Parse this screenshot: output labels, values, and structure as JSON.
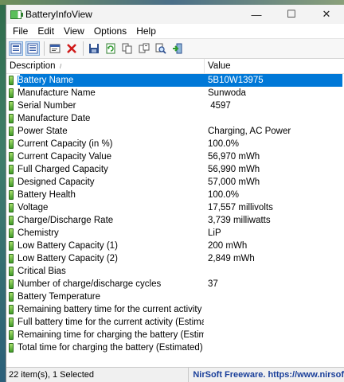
{
  "window": {
    "title": "BatteryInfoView",
    "minimize_glyph": "—",
    "maximize_glyph": "☐",
    "close_glyph": "✕"
  },
  "menu": [
    "File",
    "Edit",
    "View",
    "Options",
    "Help"
  ],
  "toolbar": {
    "icons": [
      "html-report-icon",
      "list-report-icon",
      "properties-icon",
      "delete-icon",
      "save-icon",
      "refresh-icon",
      "copy-icon",
      "copy-all-icon",
      "find-icon",
      "exit-icon"
    ]
  },
  "columns": {
    "description": "Description",
    "value": "Value",
    "sort_indicator": "/"
  },
  "rows": [
    {
      "description": "Battery Name",
      "value": "5B10W13975",
      "selected": true
    },
    {
      "description": "Manufacture Name",
      "value": "Sunwoda"
    },
    {
      "description": "Serial Number",
      "value": " 4597"
    },
    {
      "description": "Manufacture Date",
      "value": ""
    },
    {
      "description": "Power State",
      "value": "Charging, AC Power"
    },
    {
      "description": "Current Capacity (in %)",
      "value": "100.0%"
    },
    {
      "description": "Current Capacity Value",
      "value": "56,970 mWh"
    },
    {
      "description": "Full Charged Capacity",
      "value": "56,990 mWh"
    },
    {
      "description": "Designed Capacity",
      "value": "57,000 mWh"
    },
    {
      "description": "Battery Health",
      "value": "100.0%"
    },
    {
      "description": "Voltage",
      "value": "17,557 millivolts"
    },
    {
      "description": "Charge/Discharge Rate",
      "value": "3,739 milliwatts"
    },
    {
      "description": "Chemistry",
      "value": "LiP"
    },
    {
      "description": "Low Battery Capacity (1)",
      "value": "200 mWh"
    },
    {
      "description": "Low Battery Capacity (2)",
      "value": "2,849 mWh"
    },
    {
      "description": "Critical Bias",
      "value": ""
    },
    {
      "description": "Number of charge/discharge cycles",
      "value": "37"
    },
    {
      "description": "Battery Temperature",
      "value": ""
    },
    {
      "description": "Remaining battery time for the current activity (Est...",
      "value": ""
    },
    {
      "description": "Full battery time for the current activity (Estimated)",
      "value": ""
    },
    {
      "description": "Remaining time for charging the battery (Estimated)",
      "value": ""
    },
    {
      "description": "Total  time for charging the battery (Estimated)",
      "value": ""
    }
  ],
  "status": {
    "count": "22 item(s), 1 Selected",
    "credit": "NirSoft Freeware. https://www.nirsof"
  },
  "colors": {
    "selection": "#0078d7",
    "credit_text": "#1a3f9a"
  }
}
